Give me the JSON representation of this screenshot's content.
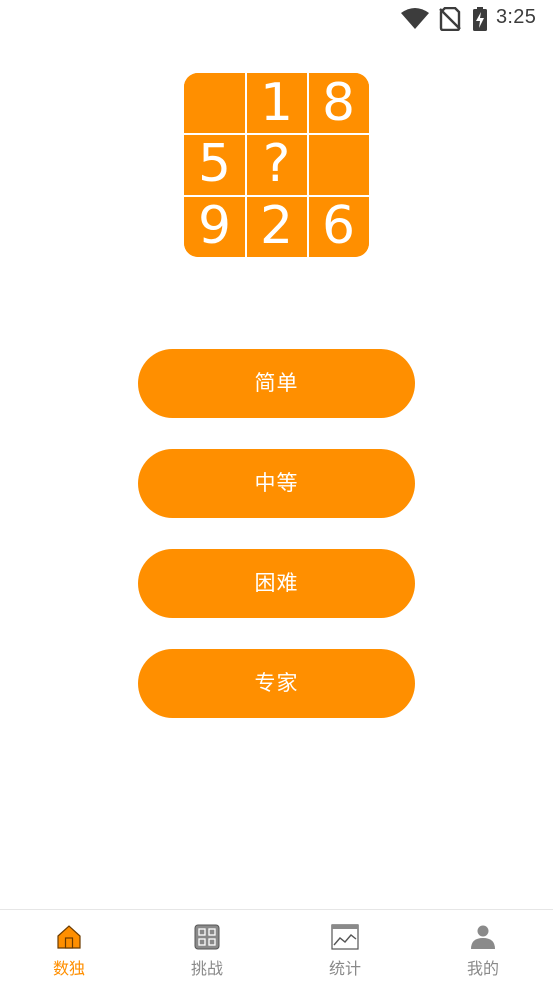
{
  "status_bar": {
    "time": "3:25",
    "icons": [
      "wifi-icon",
      "no-sim-icon",
      "battery-charging-icon"
    ]
  },
  "colors": {
    "accent": "#ff8f00",
    "inactive": "#8a8a8a",
    "background": "#ffffff"
  },
  "logo": {
    "cells": [
      "",
      "1",
      "8",
      "5",
      "?",
      "",
      "9",
      "2",
      "6"
    ]
  },
  "difficulties": [
    {
      "label": "简单"
    },
    {
      "label": "中等"
    },
    {
      "label": "困难"
    },
    {
      "label": "专家"
    }
  ],
  "bottom_nav": {
    "items": [
      {
        "label": "数独",
        "icon": "home-icon",
        "active": true
      },
      {
        "label": "挑战",
        "icon": "challenge-grid-icon",
        "active": false
      },
      {
        "label": "统计",
        "icon": "stats-chart-icon",
        "active": false
      },
      {
        "label": "我的",
        "icon": "profile-icon",
        "active": false
      }
    ]
  }
}
